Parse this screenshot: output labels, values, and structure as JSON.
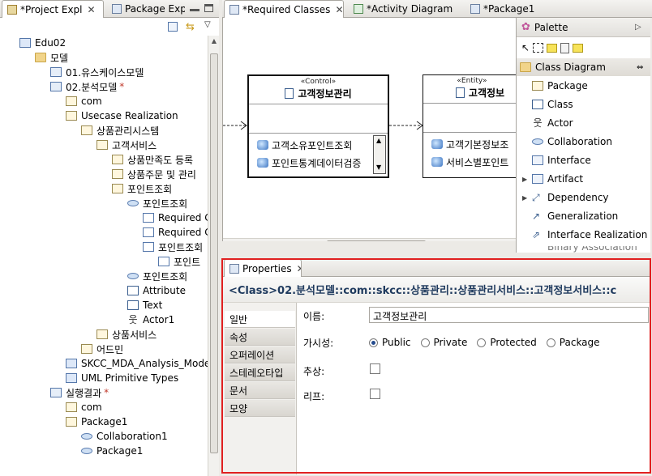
{
  "left_panel": {
    "tabs": [
      {
        "label": "*Project Expl",
        "close": "✕"
      },
      {
        "label": "Package Expl"
      }
    ],
    "tree": [
      {
        "label": "Edu02",
        "icon": "uml-icon",
        "indent": 0
      },
      {
        "label": "모델",
        "icon": "folder-icon",
        "indent": 1
      },
      {
        "label": "01.유스케이스모델",
        "icon": "model-icon",
        "indent": 2
      },
      {
        "label": "02.분석모델",
        "icon": "model-icon",
        "indent": 2,
        "star": "*"
      },
      {
        "label": "com",
        "icon": "package-icon",
        "indent": 3
      },
      {
        "label": "Usecase Realization",
        "icon": "package-icon",
        "indent": 3
      },
      {
        "label": "상품관리시스템",
        "icon": "package-icon",
        "indent": 4
      },
      {
        "label": "고객서비스",
        "icon": "package-icon",
        "indent": 5
      },
      {
        "label": "상품만족도 등록",
        "icon": "package-icon",
        "indent": 6
      },
      {
        "label": "상품주문 및 관리",
        "icon": "package-icon",
        "indent": 6
      },
      {
        "label": "포인트조회",
        "icon": "package-icon",
        "indent": 6
      },
      {
        "label": "포인트조회",
        "icon": "usecase-icon",
        "indent": 7
      },
      {
        "label": "Required C",
        "icon": "diagram-icon",
        "indent": 8
      },
      {
        "label": "Required C",
        "icon": "diagram-icon",
        "indent": 8
      },
      {
        "label": "포인트조회",
        "icon": "diagram-icon",
        "indent": 8
      },
      {
        "label": "포인트",
        "icon": "diagram-icon",
        "indent": 9
      },
      {
        "label": "포인트조회",
        "icon": "usecase-icon",
        "indent": 7
      },
      {
        "label": "Attribute",
        "icon": "class-icon",
        "indent": 7
      },
      {
        "label": "Text",
        "icon": "class-icon",
        "indent": 7
      },
      {
        "label": "Actor1",
        "icon": "actor-icon",
        "indent": 7
      },
      {
        "label": "상품서비스",
        "icon": "package-icon",
        "indent": 5
      },
      {
        "label": "어드민",
        "icon": "package-icon",
        "indent": 4
      },
      {
        "label": "SKCC_MDA_Analysis_Mode",
        "icon": "profile-icon",
        "indent": 3
      },
      {
        "label": "UML Primitive Types",
        "icon": "profile-icon",
        "indent": 3
      },
      {
        "label": "실행결과",
        "icon": "model-icon",
        "indent": 2,
        "star": "*"
      },
      {
        "label": "com",
        "icon": "package-icon",
        "indent": 3
      },
      {
        "label": "Package1",
        "icon": "package-icon",
        "indent": 3
      },
      {
        "label": "Collaboration1",
        "icon": "collaboration-icon",
        "indent": 4
      },
      {
        "label": "Package1",
        "icon": "collaboration-icon",
        "indent": 4
      }
    ]
  },
  "editor": {
    "tabs": [
      {
        "label": "*Required Classes",
        "close": "✕"
      },
      {
        "label": "*Activity Diagram"
      },
      {
        "label": "*Package1"
      }
    ],
    "diagram": {
      "control_class": {
        "stereotype": "«Control»",
        "name": "고객정보관리",
        "operations": [
          "고객소유포인트조회",
          "포인트통계데이터검증"
        ]
      },
      "entity_class": {
        "stereotype": "«Entity»",
        "name": "고객정보",
        "operations": [
          "고객기본정보조",
          "서비스별포인트"
        ]
      }
    },
    "palette": {
      "title": "Palette",
      "section": "Class Diagram",
      "items": [
        {
          "label": "Package",
          "icon": "package-icon"
        },
        {
          "label": "Class",
          "icon": "class-icon"
        },
        {
          "label": "Actor",
          "icon": "actor-icon"
        },
        {
          "label": "Collaboration",
          "icon": "collaboration-icon"
        },
        {
          "label": "Interface",
          "icon": "interface-icon"
        },
        {
          "label": "Artifact",
          "icon": "artifact-icon",
          "expandable": true
        },
        {
          "label": "Dependency",
          "icon": "dependency-icon",
          "expandable": true
        },
        {
          "label": "Generalization",
          "icon": "generalization-icon"
        },
        {
          "label": "Interface Realization",
          "icon": "realization-icon"
        }
      ],
      "partial_item": "Binary Association"
    }
  },
  "properties": {
    "tab_label": "Properties",
    "heading": "<Class>02.분석모델::com::skcc::상품관리::상품관리서비스::고객정보서비스::c",
    "tabs": [
      "일반",
      "속성",
      "오퍼레이션",
      "스테레오타입",
      "문서",
      "모양"
    ],
    "selected_tab": "일반",
    "fields": {
      "name_label": "이름:",
      "name_value": "고객정보관리",
      "visibility_label": "가시성:",
      "visibility_options": [
        "Public",
        "Private",
        "Protected",
        "Package"
      ],
      "visibility_selected": "Public",
      "abstract_label": "추상:",
      "abstract_checked": false,
      "leaf_label": "리프:",
      "leaf_checked": false
    },
    "highlight_color": "#e02020"
  }
}
